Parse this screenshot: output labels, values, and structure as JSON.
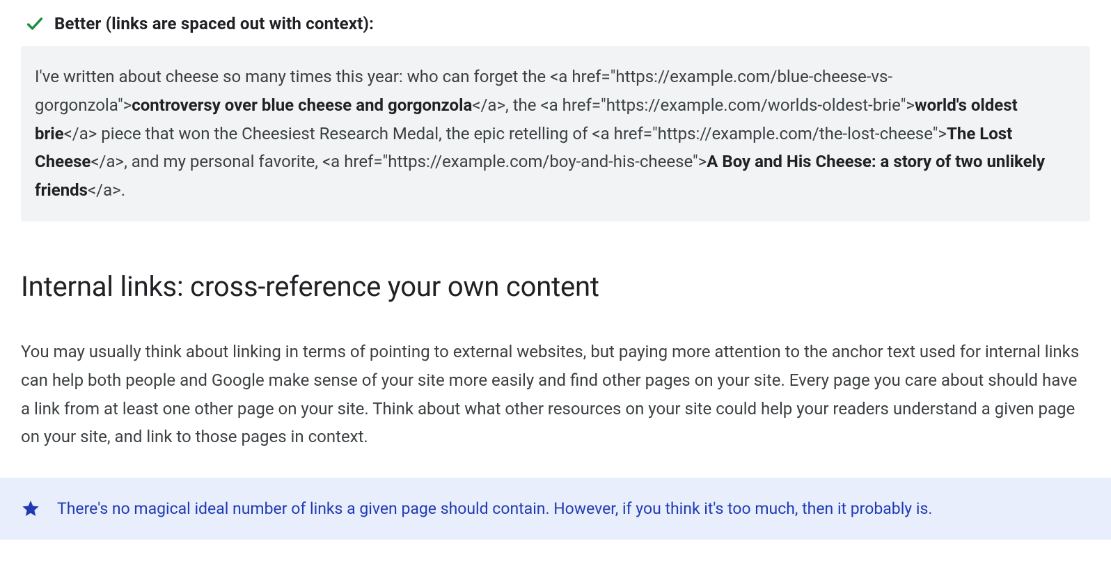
{
  "better_label": "Better (links are spaced out with context):",
  "code_example": {
    "t1": "I've written about cheese so many times this year: who can forget the <a href=\"https://example.com/blue-cheese-vs-gorgonzola\">",
    "b1": "controversy over blue cheese and gorgonzola",
    "t2": "</a>, the <a href=\"https://example.com/worlds-oldest-brie\">",
    "b2": "world's oldest brie",
    "t3": "</a> piece that won the Cheesiest Research Medal, the epic retelling of <a href=\"https://example.com/the-lost-cheese\">",
    "b3": "The Lost Cheese",
    "t4": "</a>, and my personal favorite, <a href=\"https://example.com/boy-and-his-cheese\">",
    "b4": "A Boy and His Cheese: a story of two unlikely friends",
    "t5": "</a>."
  },
  "section_heading": "Internal links: cross-reference your own content",
  "section_body": "You may usually think about linking in terms of pointing to external websites, but paying more attention to the anchor text used for internal links can help both people and Google make sense of your site more easily and find other pages on your site. Every page you care about should have a link from at least one other page on your site. Think about what other resources on your site could help your readers understand a given page on your site, and link to those pages in context.",
  "note": "There's no magical ideal number of links a given page should contain. However, if you think it's too much, then it probably is."
}
